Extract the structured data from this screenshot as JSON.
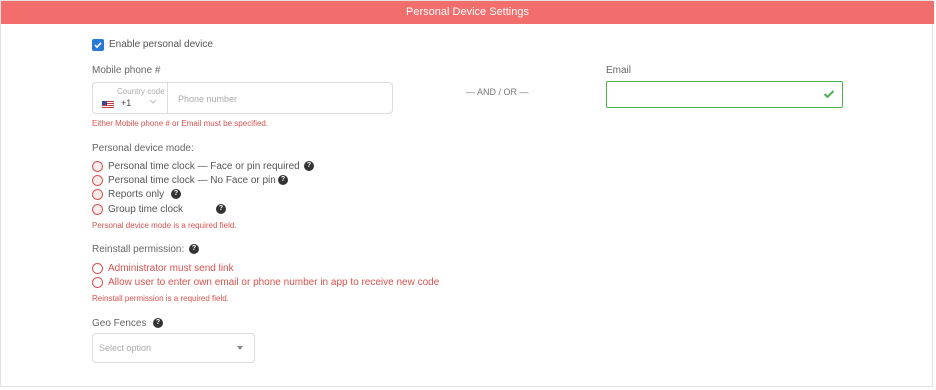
{
  "header": {
    "title": "Personal Device Settings"
  },
  "enable_device": {
    "label": "Enable personal device",
    "checked": true
  },
  "phone": {
    "label": "Mobile phone #",
    "country_code_label": "Country code",
    "country_code_value": "+1",
    "flag_icon": "us-flag-icon",
    "placeholder": "Phone number"
  },
  "separator": "— AND / OR —",
  "email": {
    "label": "Email",
    "value": "",
    "valid": true
  },
  "contact_error": "Either Mobile phone # or Email must be specified.",
  "device_mode": {
    "label": "Personal device mode:",
    "options": [
      "Personal time clock — Face or pin required",
      "Personal time clock — No Face or pin",
      "Reports only",
      "Group time clock"
    ],
    "error": "Personal device mode is a required field."
  },
  "reinstall": {
    "label": "Reinstall permission:",
    "options": [
      "Administrator must send link",
      "Allow user to enter own email or phone number in app to receive new code"
    ],
    "error": "Reinstall permission is a required field."
  },
  "geo_fences": {
    "label": "Geo Fences",
    "placeholder": "Select option"
  },
  "colors": {
    "header": "#f26e6d",
    "error": "#d9534f",
    "valid": "#4caf50",
    "checkbox": "#2a79d8"
  }
}
